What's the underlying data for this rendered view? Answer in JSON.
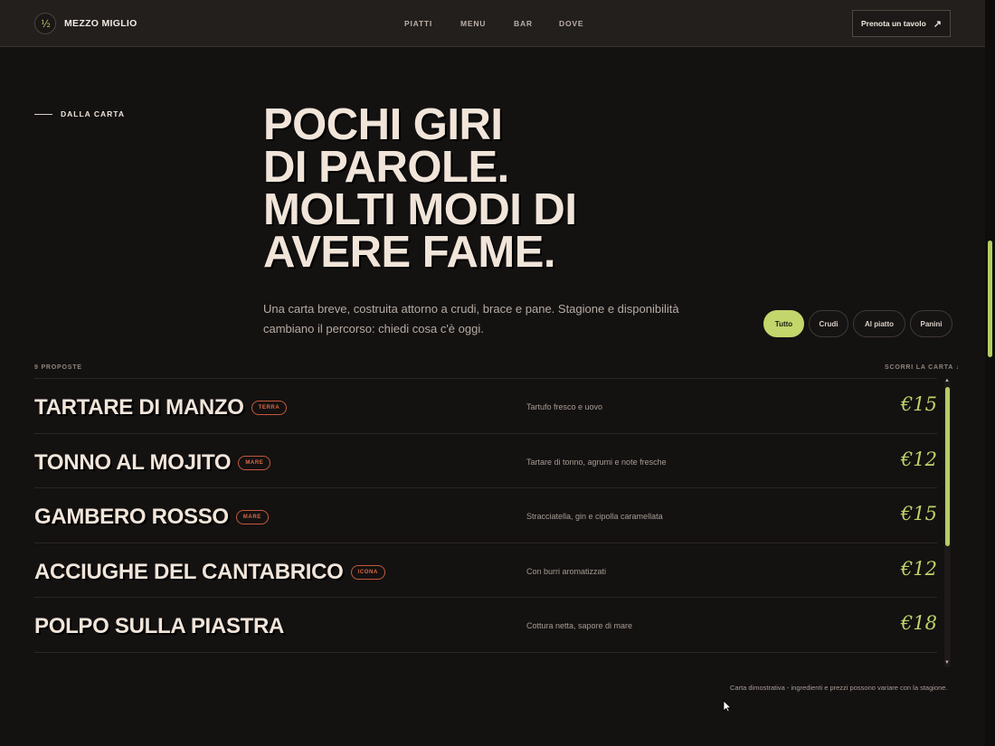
{
  "brand": {
    "logo": "½",
    "name": "MEZZO MIGLIO"
  },
  "nav": {
    "items": [
      "PIATTI",
      "MENU",
      "BAR",
      "DOVE"
    ]
  },
  "cta": {
    "label": "Prenota un tavolo",
    "icon": "arrow-up-right-icon"
  },
  "hero": {
    "eyebrow": "DALLA CARTA",
    "title_lines": [
      "POCHI GIRI",
      "DI PAROLE.",
      "MOLTI MODI DI",
      "AVERE FAME."
    ],
    "description": "Una carta breve, costruita attorno a crudi, brace e pane. Stagione e disponibilità cambiano il percorso: chiedi cosa c'è oggi."
  },
  "filters": {
    "items": [
      "Tutto",
      "Crudi",
      "Al piatto",
      "Panini"
    ],
    "selected": "Tutto"
  },
  "list": {
    "count_label": "9 PROPOSTE",
    "scroll_label": "SCORRI LA CARTA ↓",
    "items": [
      {
        "name": "TARTARE DI MANZO",
        "tag": "TERRA",
        "desc": "Tartufo fresco e uovo",
        "price": "€15"
      },
      {
        "name": "TONNO AL MOJITO",
        "tag": "MARE",
        "desc": "Tartare di tonno, agrumi e note fresche",
        "price": "€12"
      },
      {
        "name": "GAMBERO ROSSO",
        "tag": "MARE",
        "desc": "Stracciatella, gin e cipolla caramellata",
        "price": "€15"
      },
      {
        "name": "ACCIUGHE DEL CANTABRICO",
        "tag": "ICONA",
        "desc": "Con burri aromatizzati",
        "price": "€12"
      },
      {
        "name": "POLPO SULLA PIASTRA",
        "tag": "",
        "desc": "Cottura netta, sapore di mare",
        "price": "€18"
      }
    ]
  },
  "footnote": "Carta dimostrativa - ingredienti e prezzi possono variare con la stagione.",
  "colors": {
    "accent": "#c2d66b",
    "background": "#141111",
    "tag": "#d86a45"
  }
}
